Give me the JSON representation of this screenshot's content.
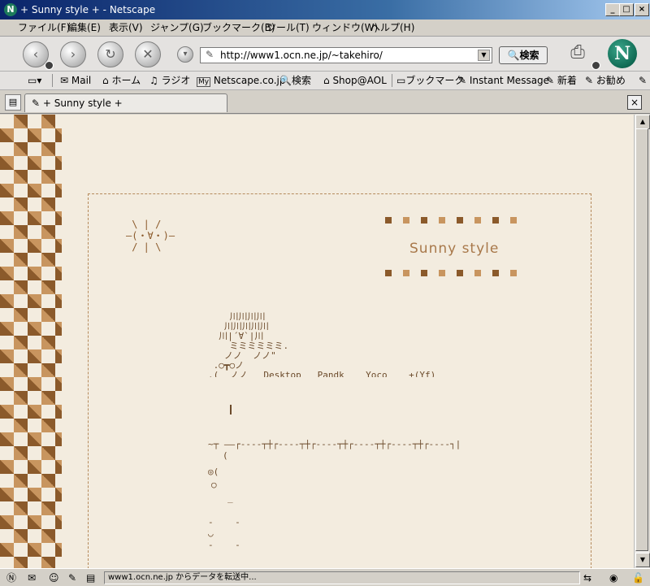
{
  "window": {
    "title": "+ Sunny style + - Netscape",
    "app_icon": "N"
  },
  "menu": [
    "ファイル(F)",
    "編集(E)",
    "表示(V)",
    "ジャンプ(G)",
    "ブックマーク(B)",
    "ツール(T)",
    "ウィンドウ(W)",
    "ヘルプ(H)"
  ],
  "nav": {
    "url": "http://www1.ocn.ne.jp/~takehiro/",
    "search_label": "検索",
    "logo": "N"
  },
  "personal_toolbar": [
    "Mail",
    "ホーム",
    "ラジオ",
    "Netscape.co.jp",
    "検索",
    "Shop@AOL",
    "ブックマーク",
    "Instant Message",
    "新着",
    "お勧め"
  ],
  "tab": {
    "label": "+ Sunny style +"
  },
  "page": {
    "site_title": "Sunny style",
    "sun_art": " \\ | /\n―(・∀・)―\n / | \\",
    "ascii_art": [
      "    川川川川",
      "   川川川川川",
      "  川|´∀`|川",
      "    ミミミミミミ.",
      "   ノノ  ノノ\"",
      " .○┳○ノ",
      ".(  ノノ   Desktop   Pandk    Yoco    +(Yf)"
    ],
    "bar_line": "~┬ ――┌‐‐‐‐┬┼┌‐‐‐‐┬┼┌‐‐‐‐┬┼┌‐‐‐‐┬┼┌‐‐‐‐┬┼┌‐‐‐‐┐|",
    "lower_art": [
      "(",
      "◎(",
      "○",
      "_",
      "‐    ‐",
      "◡",
      "‐    ‐"
    ]
  },
  "status": {
    "text": "www1.ocn.ne.jp からデータを転送中..."
  },
  "colors": {
    "dark_brown": "#8b5a2b",
    "light_brown": "#c8955f",
    "page_bg": "#f3ecdf"
  }
}
